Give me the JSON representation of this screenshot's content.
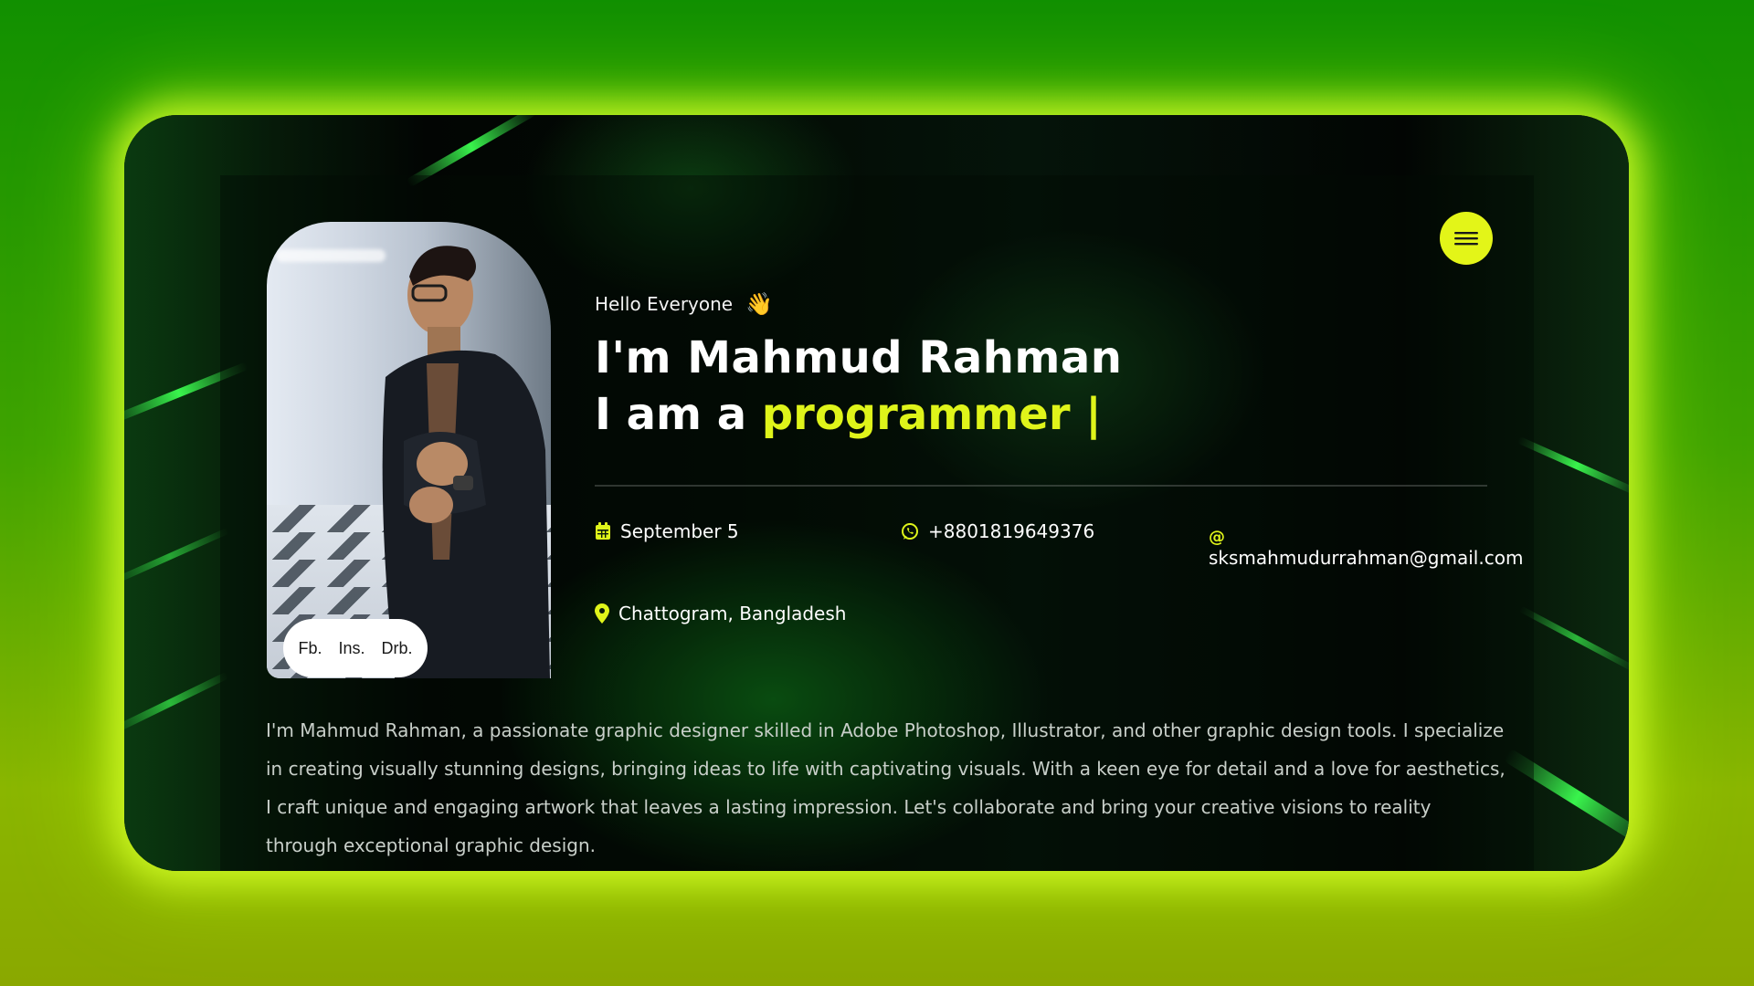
{
  "profile": {
    "greeting": "Hello Everyone",
    "wave_emoji": "👋",
    "name_line": "I'm Mahmud Rahman",
    "role_prefix": "I am a ",
    "role": "programmer |",
    "accent_color": "#dff41a"
  },
  "social": {
    "fb": "Fb.",
    "ins": "Ins.",
    "drb": "Drb."
  },
  "contact": {
    "birthday": "September 5",
    "phone": "+8801819649376",
    "email_symbol": "@",
    "email": "sksmahmudurrahman@gmail.com",
    "location": "Chattogram, Bangladesh"
  },
  "bio": "I'm Mahmud Rahman, a passionate graphic designer skilled in Adobe Photoshop, Illustrator, and other graphic design tools. I specialize in creating visually stunning designs, bringing ideas to life with captivating visuals. With a keen eye for detail and a love for aesthetics, I craft unique and engaging artwork that leaves a lasting impression. Let's collaborate and bring your creative visions to reality through exceptional graphic design.",
  "icons": {
    "menu": "hamburger-icon",
    "calendar": "calendar-icon",
    "phone": "whatsapp-icon",
    "location": "map-pin-icon"
  }
}
